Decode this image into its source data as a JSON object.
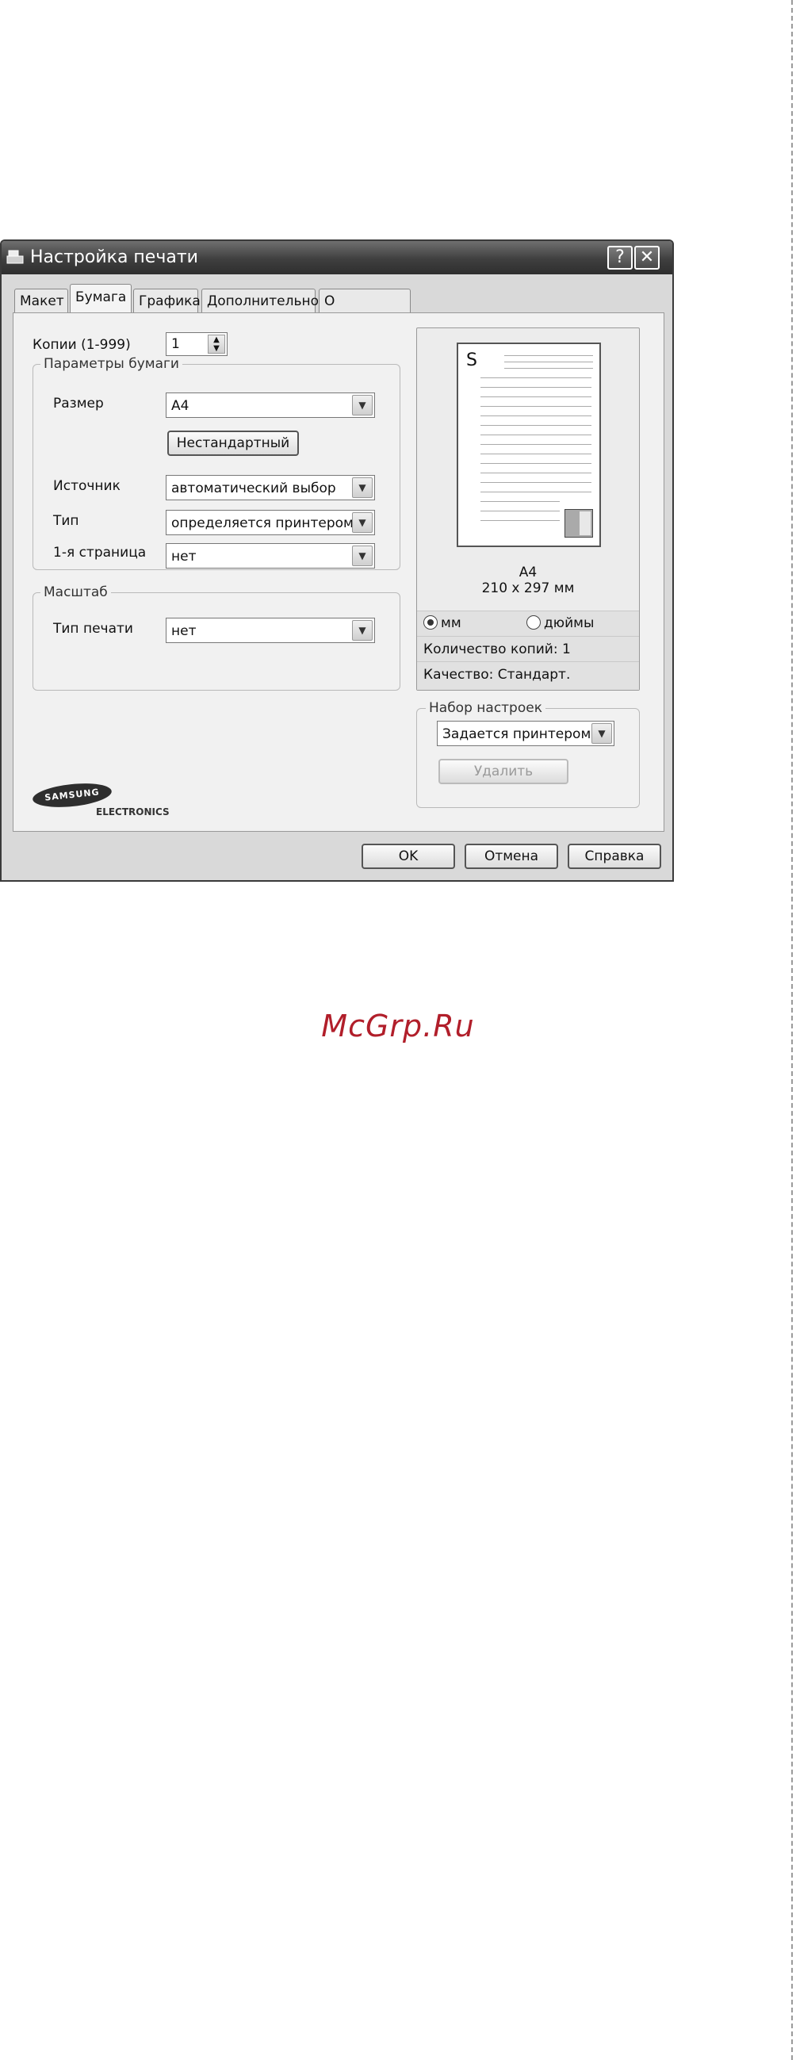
{
  "window": {
    "title": "Настройка печати",
    "help_button": "?",
    "close_button": "✕"
  },
  "tabs": [
    {
      "label": "Макет"
    },
    {
      "label": "Бумага"
    },
    {
      "label": "Графика"
    },
    {
      "label": "Дополнительно"
    },
    {
      "label": "О программе"
    }
  ],
  "copies": {
    "label": "Копии (1-999)",
    "value": "1"
  },
  "paper_group": {
    "title": "Параметры бумаги",
    "size_label": "Размер",
    "size_value": "A4",
    "custom_button": "Нестандартный",
    "source_label": "Источник",
    "source_value": "автоматический выбор",
    "type_label": "Тип",
    "type_value": "определяется принтером",
    "first_page_label": "1-я страница",
    "first_page_value": "нет"
  },
  "scale_group": {
    "title": "Масштаб",
    "print_type_label": "Тип печати",
    "print_type_value": "нет"
  },
  "brand": {
    "name": "SAMSUNG",
    "sub": "ELECTRONICS"
  },
  "preview": {
    "page_letter": "S",
    "paper_name": "A4",
    "paper_dims": "210 x 297 мм",
    "unit_mm": "мм",
    "unit_inch": "дюймы",
    "selected_unit": "мм",
    "copies_info": "Количество копий: 1",
    "quality_info": "Качество: Стандарт."
  },
  "presets": {
    "title": "Набор настроек",
    "value": "Задается принтером",
    "delete_button": "Удалить"
  },
  "footer": {
    "ok": "OK",
    "cancel": "Отмена",
    "help": "Справка"
  },
  "watermark": "McGrp.Ru"
}
